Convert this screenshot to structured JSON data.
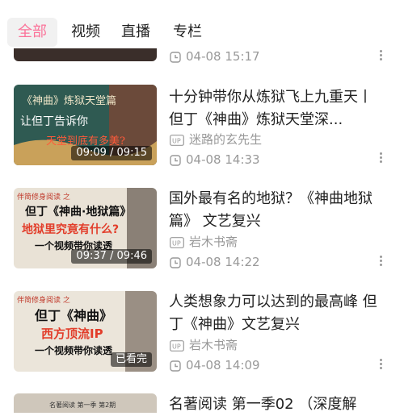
{
  "tabs": [
    {
      "label": "全部"
    },
    {
      "label": "视频"
    },
    {
      "label": "直播"
    },
    {
      "label": "专栏"
    }
  ],
  "colors": {
    "accent": "#fb7299",
    "meta": "#999999"
  },
  "top_partial": {
    "date": "04-08 15:17"
  },
  "videos": [
    {
      "title": "十分钟带你从炼狱飞上九重天丨但丁《神曲》炼狱天堂深...",
      "duration": "09:09 / 09:15",
      "uploader": "迷路的玄先生",
      "date": "04-08 14:33",
      "thumb_lines": [
        "《神曲》炼狱天堂篇",
        "让但丁告诉你",
        "天堂到底有多美?"
      ]
    },
    {
      "title": "国外最有名的地狱？《神曲地狱篇》 文艺复兴",
      "duration": "09:37 / 09:46",
      "uploader": "岩木书斋",
      "date": "04-08 14:22",
      "thumb_lines": [
        "伴简修身阅读 之",
        "但丁《神曲·地狱篇》",
        "地狱里究竟有什么?",
        "一个视频带你读透"
      ]
    },
    {
      "title": "人类想象力可以达到的最高峰 但丁《神曲》文艺复兴",
      "duration": "已看完",
      "uploader": "岩木书斋",
      "date": "04-08 14:09",
      "thumb_lines": [
        "伴简修身阅读 之",
        "但丁《神曲》",
        "西方顶流IP",
        "一个视频带你读透"
      ]
    },
    {
      "title": "名著阅读 第一季02 （深度解",
      "thumb_lines": [
        "名著阅读 第一季 第2期"
      ]
    }
  ]
}
